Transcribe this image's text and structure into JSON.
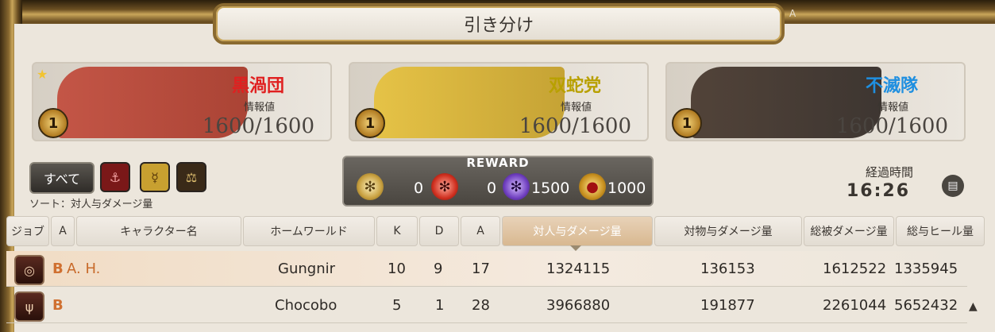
{
  "title": "引き分け",
  "corner_mark": "A",
  "teams": [
    {
      "name": "黒渦団",
      "name_color": "#e02020",
      "banner_color": "#b03028",
      "info_label": "情報値",
      "info_value": "1600/1600",
      "rank": "1",
      "starred": true
    },
    {
      "name": "双蛇党",
      "name_color": "#b8a000",
      "banner_color": "#d8b020",
      "info_label": "情報値",
      "info_value": "1600/1600",
      "rank": "1",
      "starred": false
    },
    {
      "name": "不滅隊",
      "name_color": "#1f8fe0",
      "banner_color": "#2a2220",
      "info_label": "情報値",
      "info_value": "1600/1600",
      "rank": "1",
      "starred": false
    }
  ],
  "filters": {
    "all_label": "すべて",
    "sort_label": "ソート：対人与ダメージ量"
  },
  "reward": {
    "title": "REWARD",
    "items": [
      {
        "icon": "gold-wheel-icon",
        "value": "0"
      },
      {
        "icon": "red-wheel-icon",
        "value": "0"
      },
      {
        "icon": "purple-wheel-icon",
        "value": "1500"
      },
      {
        "icon": "gold-medal-icon",
        "value": "1000"
      }
    ]
  },
  "elapsed": {
    "label": "経過時間",
    "time": "16:26"
  },
  "columns": [
    "ジョブ",
    "A",
    "キャラクター名",
    "ホームワールド",
    "K",
    "D",
    "A",
    "対人与ダメージ量",
    "対物与ダメージ量",
    "総被ダメージ量",
    "総与ヒール量"
  ],
  "rows": [
    {
      "mark": "B",
      "name": "A. H.",
      "world": "Gungnir",
      "k": "10",
      "d": "9",
      "a": "17",
      "pvp_dmg": "1324115",
      "obj_dmg": "136153",
      "taken": "1612522",
      "heal": "1335945"
    },
    {
      "mark": "B",
      "name": "",
      "world": "Chocobo",
      "k": "5",
      "d": "1",
      "a": "28",
      "pvp_dmg": "3966880",
      "obj_dmg": "191877",
      "taken": "2261044",
      "heal": "5652432"
    }
  ]
}
